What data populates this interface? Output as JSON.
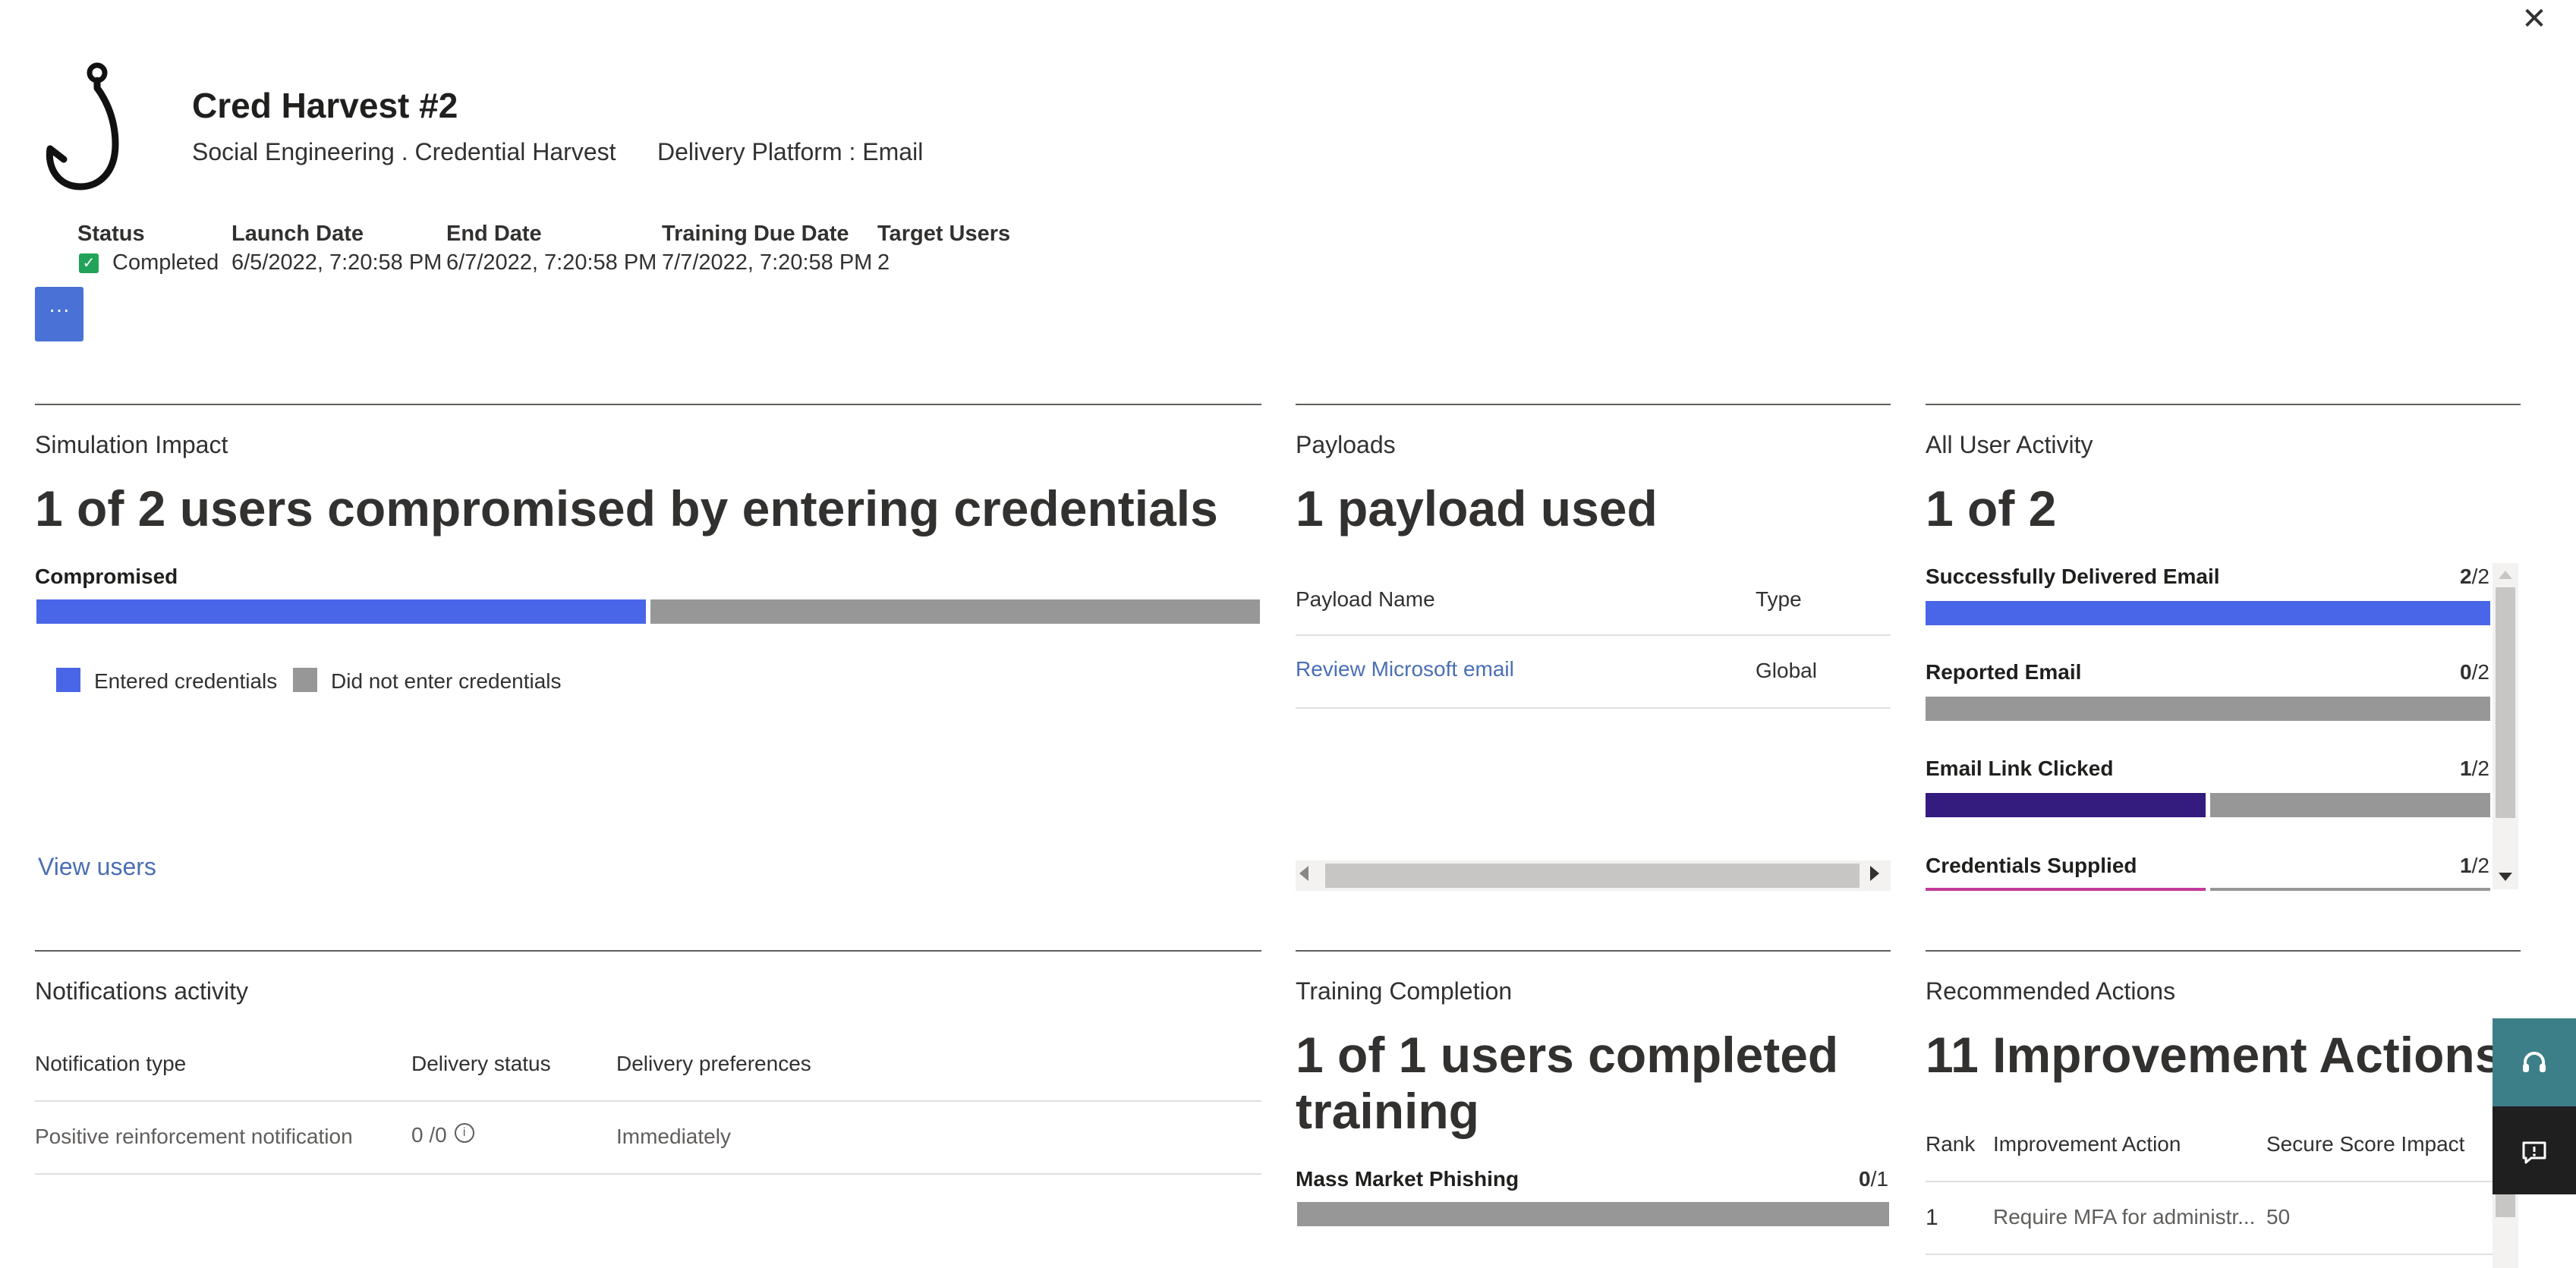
{
  "header": {
    "title": "Cred Harvest #2",
    "subtitle": "Social Engineering . Credential Harvest",
    "platform": "Delivery Platform : Email",
    "close_glyph": "✕",
    "more_glyph": "···"
  },
  "meta": {
    "status_label": "Status",
    "status_value": "Completed",
    "launch_label": "Launch Date",
    "launch_value": "6/5/2022, 7:20:58 PM",
    "end_label": "End Date",
    "end_value": "6/7/2022, 7:20:58 PM",
    "training_label": "Training Due Date",
    "training_value": "7/7/2022, 7:20:58 PM",
    "target_label": "Target Users",
    "target_value": "2"
  },
  "impact": {
    "section": "Simulation Impact",
    "headline": "1 of 2 users compromised by entering credentials",
    "bar_label": "Compromised",
    "compromised_fraction": 0.5,
    "legend_entered": "Entered credentials",
    "legend_not_entered": "Did not enter credentials",
    "view_users": "View users",
    "color_entered": "#4a66e8",
    "color_not": "#979797"
  },
  "payloads": {
    "section": "Payloads",
    "headline": "1 payload used",
    "col_name": "Payload Name",
    "col_type": "Type",
    "rows": [
      {
        "name": "Review Microsoft email",
        "type": "Global"
      }
    ]
  },
  "activity": {
    "section": "All User Activity",
    "headline": "1 of 2",
    "items": [
      {
        "label": "Successfully Delivered Email",
        "num": "2",
        "den": "/2",
        "fraction": 1.0,
        "color": "#4a66e8"
      },
      {
        "label": "Reported Email",
        "num": "0",
        "den": "/2",
        "fraction": 0.0,
        "color": "#4a66e8"
      },
      {
        "label": "Email Link Clicked",
        "num": "1",
        "den": "/2",
        "fraction": 0.5,
        "color": "#341b7e"
      },
      {
        "label": "Credentials Supplied",
        "num": "1",
        "den": "/2",
        "fraction": 0.5,
        "color": "#c23b9a"
      }
    ]
  },
  "notifications": {
    "section": "Notifications activity",
    "col_type": "Notification type",
    "col_status": "Delivery status",
    "col_pref": "Delivery preferences",
    "rows": [
      {
        "type": "Positive reinforcement notification",
        "status": "0 /0",
        "pref": "Immediately"
      }
    ]
  },
  "training": {
    "section": "Training Completion",
    "headline_line1": "1 of 1 users completed",
    "headline_line2": "training",
    "item_label": "Mass Market Phishing",
    "item_num": "0",
    "item_den": "/1",
    "item_fraction": 0.0
  },
  "recommended": {
    "section": "Recommended Actions",
    "headline": "11 Improvement Actions",
    "col_rank": "Rank",
    "col_action": "Improvement Action",
    "col_impact": "Secure Score Impact",
    "rows": [
      {
        "rank": "1",
        "action": "Require MFA for administr...",
        "impact": "50"
      }
    ]
  },
  "icons": {
    "hook": "fishing-hook-icon",
    "check": "✓",
    "info": "i",
    "headset": "headset-icon",
    "feedback": "feedback-icon"
  }
}
